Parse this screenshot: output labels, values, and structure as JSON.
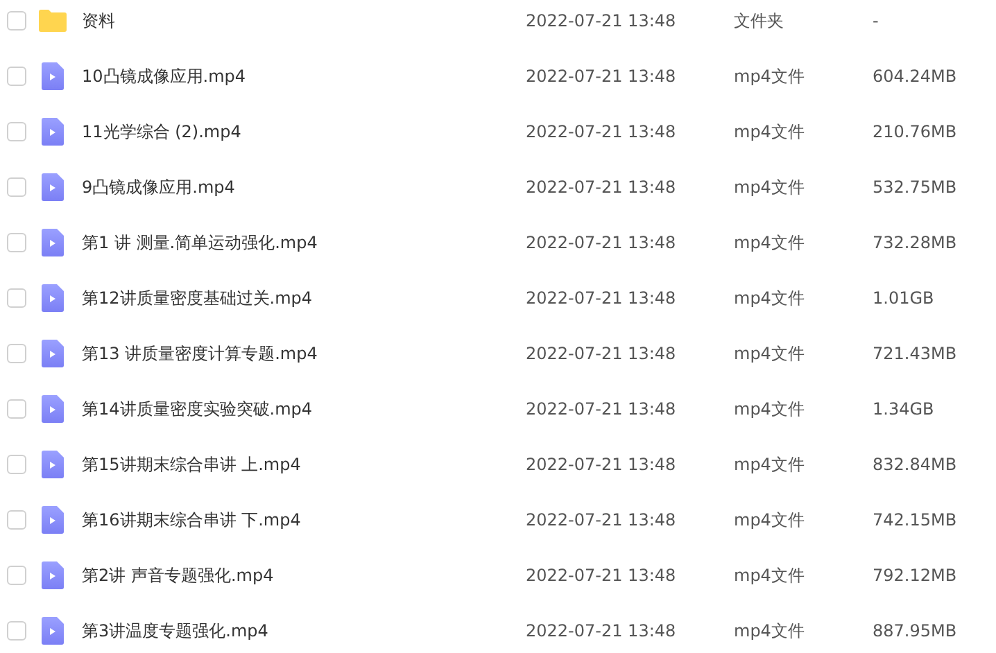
{
  "files": [
    {
      "kind": "folder",
      "name": "资料",
      "modified": "2022-07-21 13:48",
      "type": "文件夹",
      "size": "-",
      "checked": false
    },
    {
      "kind": "video",
      "name": "10凸镜成像应用.mp4",
      "modified": "2022-07-21 13:48",
      "type": "mp4文件",
      "size": "604.24MB",
      "checked": false
    },
    {
      "kind": "video",
      "name": "11光学综合 (2).mp4",
      "modified": "2022-07-21 13:48",
      "type": "mp4文件",
      "size": "210.76MB",
      "checked": false
    },
    {
      "kind": "video",
      "name": "9凸镜成像应用.mp4",
      "modified": "2022-07-21 13:48",
      "type": "mp4文件",
      "size": "532.75MB",
      "checked": false
    },
    {
      "kind": "video",
      "name": "第1 讲 测量.简单运动强化.mp4",
      "modified": "2022-07-21 13:48",
      "type": "mp4文件",
      "size": "732.28MB",
      "checked": false
    },
    {
      "kind": "video",
      "name": "第12讲质量密度基础过关.mp4",
      "modified": "2022-07-21 13:48",
      "type": "mp4文件",
      "size": "1.01GB",
      "checked": false
    },
    {
      "kind": "video",
      "name": "第13 讲质量密度计算专题.mp4",
      "modified": "2022-07-21 13:48",
      "type": "mp4文件",
      "size": "721.43MB",
      "checked": false
    },
    {
      "kind": "video",
      "name": "第14讲质量密度实验突破.mp4",
      "modified": "2022-07-21 13:48",
      "type": "mp4文件",
      "size": "1.34GB",
      "checked": false
    },
    {
      "kind": "video",
      "name": "第15讲期末综合串讲 上.mp4",
      "modified": "2022-07-21 13:48",
      "type": "mp4文件",
      "size": "832.84MB",
      "checked": false
    },
    {
      "kind": "video",
      "name": "第16讲期末综合串讲 下.mp4",
      "modified": "2022-07-21 13:48",
      "type": "mp4文件",
      "size": "742.15MB",
      "checked": false
    },
    {
      "kind": "video",
      "name": "第2讲 声音专题强化.mp4",
      "modified": "2022-07-21 13:48",
      "type": "mp4文件",
      "size": "792.12MB",
      "checked": false
    },
    {
      "kind": "video",
      "name": "第3讲温度专题强化.mp4",
      "modified": "2022-07-21 13:48",
      "type": "mp4文件",
      "size": "887.95MB",
      "checked": false
    }
  ]
}
